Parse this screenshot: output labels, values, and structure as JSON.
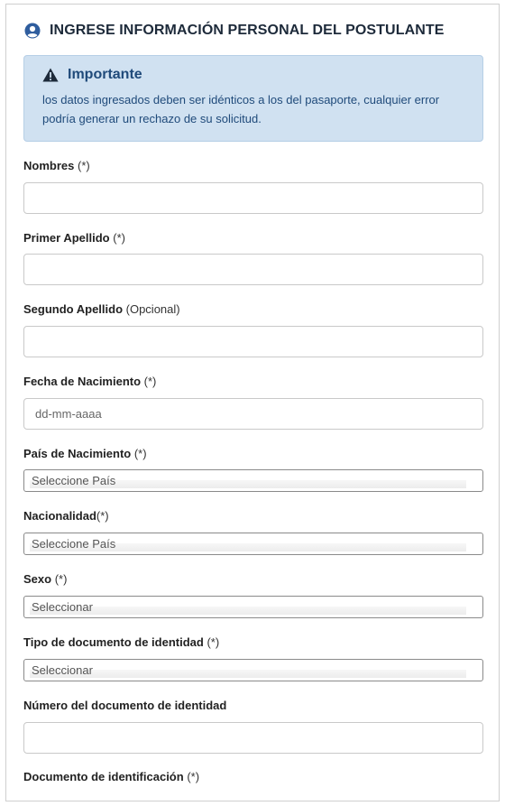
{
  "header": {
    "title": "INGRESE INFORMACIÓN PERSONAL DEL POSTULANTE",
    "icon": "user-circle-icon"
  },
  "alert": {
    "title": "Importante",
    "icon": "warning-icon",
    "text_line1": "los datos ingresados deben ser idénticos a los del pasaporte, cualquier error",
    "text_line2": "podría generar un rechazo de su solicitud."
  },
  "fields": {
    "nombres": {
      "label": "Nombres",
      "note": "(*)",
      "value": ""
    },
    "primer_apellido": {
      "label": "Primer Apellido",
      "note": "(*)",
      "value": ""
    },
    "segundo_apellido": {
      "label": "Segundo Apellido",
      "note": "(Opcional)",
      "value": ""
    },
    "fecha_nacimiento": {
      "label": "Fecha de Nacimiento",
      "note": "(*)",
      "placeholder": "dd-mm-aaaa",
      "value": ""
    },
    "pais_nacimiento": {
      "label": "País de Nacimiento",
      "note": "(*)",
      "selected": "Seleccione País"
    },
    "nacionalidad": {
      "label": "Nacionalidad",
      "note": "(*)",
      "selected": "Seleccione País"
    },
    "sexo": {
      "label": "Sexo",
      "note": "(*)",
      "selected": "Seleccionar"
    },
    "tipo_documento": {
      "label": "Tipo de documento de identidad",
      "note": "(*)",
      "selected": "Seleccionar"
    },
    "numero_documento": {
      "label": "Número del documento de identidad",
      "value": ""
    },
    "documento_identificacion": {
      "label": "Documento de identificación",
      "note": "(*)"
    }
  },
  "colors": {
    "accent": "#1f4a7a",
    "alert_bg": "#d0e1f1",
    "header_icon": "#2f5d9e"
  }
}
